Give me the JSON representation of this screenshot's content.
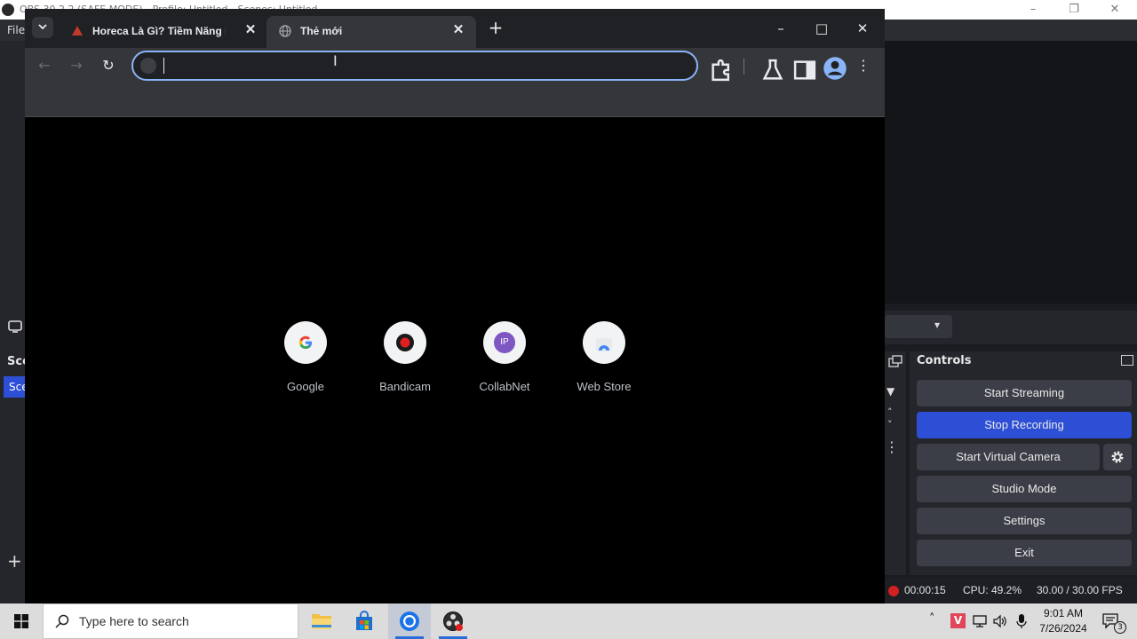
{
  "obs": {
    "title_text": "OBS 30.2.2 (SAFE MODE) - Profile: Untitled - Scenes: Untitled",
    "menu_file": "File",
    "scenes_title": "Sce",
    "scene_item": "Sce",
    "controls": {
      "title": "Controls",
      "start_streaming": "Start Streaming",
      "stop_recording": "Stop Recording",
      "start_virtual_camera": "Start Virtual Camera",
      "studio_mode": "Studio Mode",
      "settings": "Settings",
      "exit": "Exit"
    },
    "status": {
      "rec_time": "00:00:15",
      "cpu": "CPU: 49.2%",
      "fps": "30.00 / 30.00 FPS"
    }
  },
  "chrome": {
    "tabs": [
      {
        "label": "Horeca Là Gì? Tiềm Năng Phát"
      },
      {
        "label": "Thẻ mới"
      }
    ],
    "omnibox": {
      "value": ""
    },
    "shortcuts": [
      {
        "label": "Google"
      },
      {
        "label": "Bandicam"
      },
      {
        "label": "CollabNet"
      },
      {
        "label": "Web Store"
      }
    ],
    "collabnet_initials": "IP"
  },
  "taskbar": {
    "search_placeholder": "Type here to search",
    "time": "9:01 AM",
    "date": "7/26/2024",
    "notification_count": "3"
  },
  "colors": {
    "accent_blue": "#2d4fd6",
    "chrome_focus": "#8ab4f8",
    "recording_red": "#d32020"
  }
}
